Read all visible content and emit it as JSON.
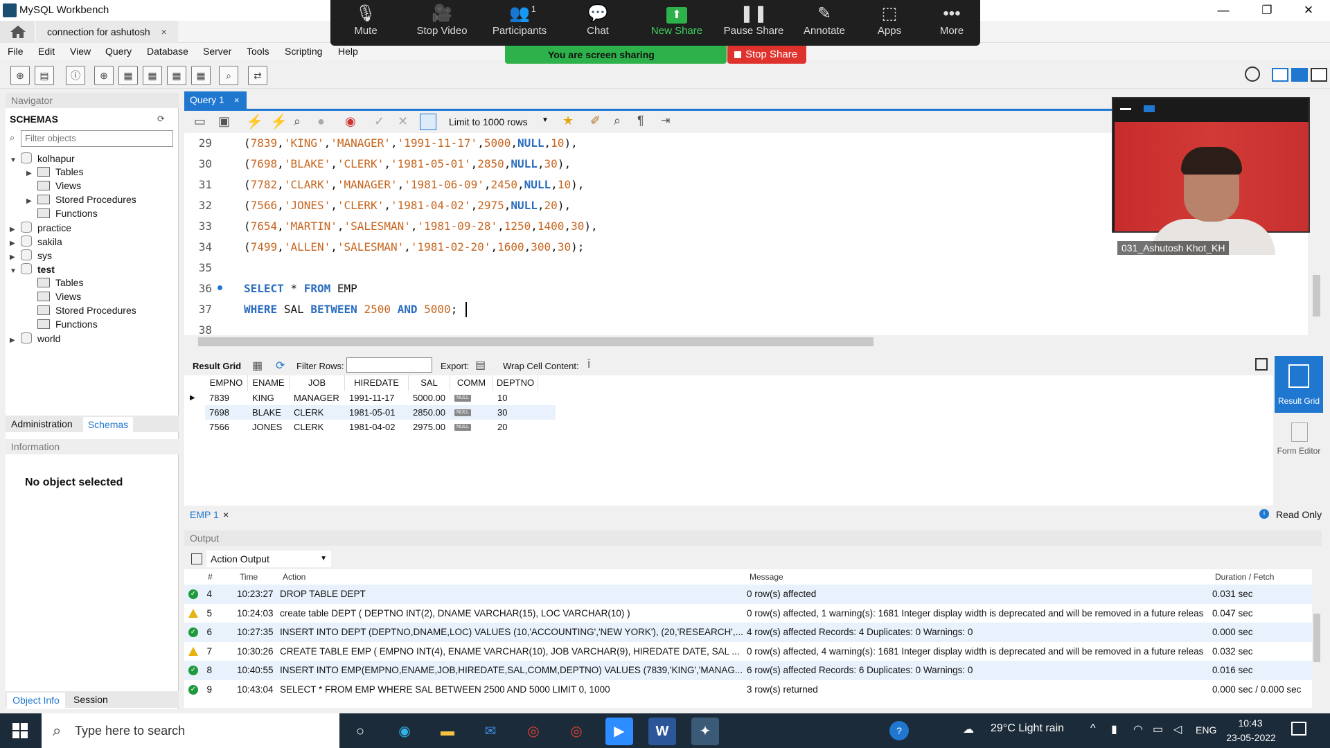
{
  "window": {
    "title": "MySQL Workbench",
    "controls": [
      "—",
      "❐",
      "✕"
    ]
  },
  "connection_tab": {
    "label": "connection for ashutosh",
    "close": "×"
  },
  "menu": [
    "File",
    "Edit",
    "View",
    "Query",
    "Database",
    "Server",
    "Tools",
    "Scripting",
    "Help"
  ],
  "zoom": {
    "items": [
      {
        "icon": "🎙",
        "label": "Mute"
      },
      {
        "icon": "🎥",
        "label": "Stop Video"
      },
      {
        "icon": "👥",
        "label": "Participants",
        "badge": "1"
      },
      {
        "icon": "💬",
        "label": "Chat"
      },
      {
        "icon": "⬆",
        "label": "New Share"
      },
      {
        "icon": "❚❚",
        "label": "Pause Share"
      },
      {
        "icon": "✎",
        "label": "Annotate"
      },
      {
        "icon": "⬚",
        "label": "Apps"
      },
      {
        "icon": "•••",
        "label": "More"
      }
    ],
    "sharing_text": "You are screen sharing",
    "stop_share": "Stop Share"
  },
  "navigator": {
    "header": "Navigator",
    "schemas_label": "SCHEMAS",
    "filter_placeholder": "Filter objects",
    "tree": [
      {
        "label": "kolhapur",
        "level": 0,
        "expanded": true,
        "bold": false,
        "type": "db"
      },
      {
        "label": "Tables",
        "level": 1,
        "expanded": false,
        "type": "folder",
        "arrow": true
      },
      {
        "label": "Views",
        "level": 1,
        "type": "folder",
        "arrow": false
      },
      {
        "label": "Stored Procedures",
        "level": 1,
        "type": "folder",
        "arrow": true
      },
      {
        "label": "Functions",
        "level": 1,
        "type": "folder",
        "arrow": false
      },
      {
        "label": "practice",
        "level": 0,
        "expanded": false,
        "type": "db"
      },
      {
        "label": "sakila",
        "level": 0,
        "expanded": false,
        "type": "db"
      },
      {
        "label": "sys",
        "level": 0,
        "expanded": false,
        "type": "db"
      },
      {
        "label": "test",
        "level": 0,
        "expanded": true,
        "bold": true,
        "type": "db"
      },
      {
        "label": "Tables",
        "level": 1,
        "type": "folder",
        "arrow": false
      },
      {
        "label": "Views",
        "level": 1,
        "type": "folder",
        "arrow": false
      },
      {
        "label": "Stored Procedures",
        "level": 1,
        "type": "folder",
        "arrow": false
      },
      {
        "label": "Functions",
        "level": 1,
        "type": "folder",
        "arrow": false
      },
      {
        "label": "world",
        "level": 0,
        "expanded": false,
        "type": "db"
      }
    ],
    "tabs": [
      "Administration",
      "Schemas"
    ],
    "info_header": "Information",
    "no_object": "No object selected",
    "bottom_tabs": [
      "Object Info",
      "Session"
    ]
  },
  "editor": {
    "tab_label": "Query 1",
    "limit_label": "Limit to 1000 rows",
    "lines": [
      {
        "n": "29",
        "code": "(7839,'KING','MANAGER','1991-11-17',5000,NULL,10),"
      },
      {
        "n": "30",
        "code": "(7698,'BLAKE','CLERK','1981-05-01',2850,NULL,30),"
      },
      {
        "n": "31",
        "code": "(7782,'CLARK','MANAGER','1981-06-09',2450,NULL,10),"
      },
      {
        "n": "32",
        "code": "(7566,'JONES','CLERK','1981-04-02',2975,NULL,20),"
      },
      {
        "n": "33",
        "code": "(7654,'MARTIN','SALESMAN','1981-09-28',1250,1400,30),"
      },
      {
        "n": "34",
        "code": "(7499,'ALLEN','SALESMAN','1981-02-20',1600,300,30);"
      },
      {
        "n": "35",
        "code": ""
      },
      {
        "n": "36",
        "code": "SELECT * FROM EMP"
      },
      {
        "n": "37",
        "code": "WHERE SAL BETWEEN 2500 AND 5000;"
      },
      {
        "n": "38",
        "code": ""
      }
    ]
  },
  "result": {
    "toolbar": {
      "grid": "Result Grid",
      "filter": "Filter Rows:",
      "export": "Export:",
      "wrap": "Wrap Cell Content:"
    },
    "columns": [
      "EMPNO",
      "ENAME",
      "JOB",
      "HIREDATE",
      "SAL",
      "COMM",
      "DEPTNO"
    ],
    "rows": [
      [
        "7839",
        "KING",
        "MANAGER",
        "1991-11-17",
        "5000.00",
        "NULL",
        "10"
      ],
      [
        "7698",
        "BLAKE",
        "CLERK",
        "1981-05-01",
        "2850.00",
        "NULL",
        "30"
      ],
      [
        "7566",
        "JONES",
        "CLERK",
        "1981-04-02",
        "2975.00",
        "NULL",
        "20"
      ]
    ],
    "side": {
      "result_grid": "Result Grid",
      "form_editor": "Form Editor"
    },
    "tab": "EMP 1",
    "read_only": "Read Only"
  },
  "output": {
    "header": "Output",
    "selector": "Action Output",
    "columns": [
      "#",
      "Time",
      "Action",
      "Message",
      "Duration / Fetch"
    ],
    "rows": [
      {
        "status": "ok",
        "n": "4",
        "time": "10:23:27",
        "action": "DROP TABLE DEPT",
        "message": "0 row(s) affected",
        "duration": "0.031 sec"
      },
      {
        "status": "warn",
        "n": "5",
        "time": "10:24:03",
        "action": "create table DEPT ( DEPTNO INT(2),  DNAME VARCHAR(15), LOC VARCHAR(10) )",
        "message": "0 row(s) affected, 1 warning(s): 1681 Integer display width is deprecated and will be removed in a future release.",
        "duration": "0.047 sec"
      },
      {
        "status": "ok",
        "n": "6",
        "time": "10:27:35",
        "action": "INSERT INTO DEPT (DEPTNO,DNAME,LOC) VALUES (10,'ACCOUNTING','NEW YORK'), (20,'RESEARCH',...",
        "message": "4 row(s) affected Records: 4  Duplicates: 0  Warnings: 0",
        "duration": "0.000 sec"
      },
      {
        "status": "warn",
        "n": "7",
        "time": "10:30:26",
        "action": "CREATE TABLE EMP ( EMPNO INT(4), ENAME VARCHAR(10), JOB VARCHAR(9), HIREDATE DATE, SAL ...",
        "message": "0 row(s) affected, 4 warning(s): 1681 Integer display width is deprecated and will be removed in a future release...",
        "duration": "0.032 sec"
      },
      {
        "status": "ok",
        "n": "8",
        "time": "10:40:55",
        "action": "INSERT INTO EMP(EMPNO,ENAME,JOB,HIREDATE,SAL,COMM,DEPTNO) VALUES (7839,'KING','MANAG...",
        "message": "6 row(s) affected Records: 6  Duplicates: 0  Warnings: 0",
        "duration": "0.016 sec"
      },
      {
        "status": "ok",
        "n": "9",
        "time": "10:43:04",
        "action": "SELECT * FROM EMP WHERE SAL BETWEEN 2500 AND 5000 LIMIT 0, 1000",
        "message": "3 row(s) returned",
        "duration": "0.000 sec / 0.000 sec"
      }
    ]
  },
  "webcam": {
    "name": "031_Ashutosh Khot_KH"
  },
  "taskbar": {
    "search_placeholder": "Type here to search",
    "weather": "29°C  Light rain",
    "lang": "ENG",
    "time": "10:43",
    "date": "23-05-2022"
  }
}
